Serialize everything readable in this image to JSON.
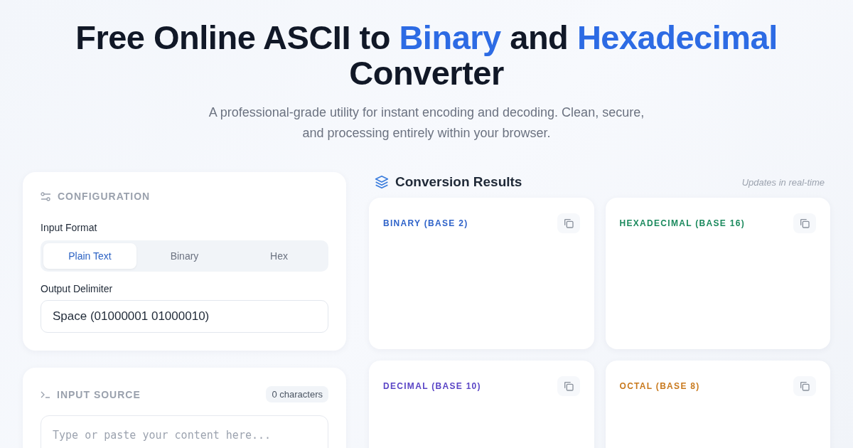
{
  "header": {
    "title_lines": [
      [
        {
          "text": "Free Online ASCII to ",
          "highlight": false
        },
        {
          "text": "Binary",
          "highlight": true
        },
        {
          "text": " and ",
          "highlight": false
        },
        {
          "text": "Hexadecimal",
          "highlight": true
        }
      ],
      [
        {
          "text": "Converter",
          "highlight": false
        }
      ]
    ],
    "subtitle_lines": [
      "A professional-grade utility for instant encoding and decoding. Clean, secure,",
      "and processing entirely within your browser."
    ]
  },
  "configuration": {
    "title": "CONFIGURATION",
    "input_format_label": "Input Format",
    "formats": [
      {
        "label": "Plain Text",
        "selected": true
      },
      {
        "label": "Binary",
        "selected": false
      },
      {
        "label": "Hex",
        "selected": false
      }
    ],
    "delimiter_label": "Output Delimiter",
    "delimiter_value": "Space (01000001 01000010)"
  },
  "input_source": {
    "title": "INPUT SOURCE",
    "count": "0 characters",
    "placeholder": "Type or paste your content here..."
  },
  "results": {
    "title": "Conversion Results",
    "note": "Updates in real-time",
    "cards": [
      {
        "label": "BINARY (BASE 2)",
        "color": "#2f63c9"
      },
      {
        "label": "HEXADECIMAL (BASE 16)",
        "color": "#1c8a5e"
      },
      {
        "label": "DECIMAL (BASE 10)",
        "color": "#5a45c6"
      },
      {
        "label": "OCTAL (BASE 8)",
        "color": "#c97a1e"
      }
    ]
  }
}
